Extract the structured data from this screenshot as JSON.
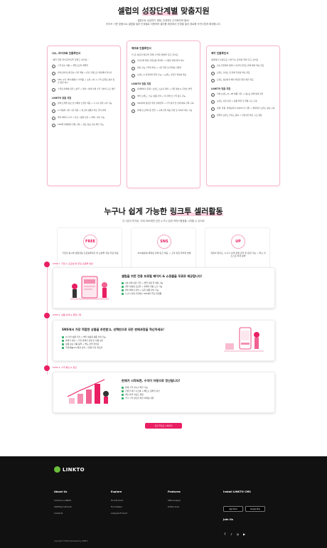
{
  "section1": {
    "title_plain": "셀럽의 ",
    "title_hl": "성장단계별",
    "title_rest": " 맞춤지원",
    "subtitle_l1": "셀럽으로 성공하기 위해, 단계적인 수익화전략 필요!",
    "subtitle_l2": "라이브 기준 맞춤으로 셀럽별 셀러 단계별로 지원하며 셀러를 확장에서 단계별 셀러 경로를 자연스럽게 확대합니다.",
    "cards": [
      {
        "head": "나노, 마이크로 인플루언서",
        "intro": "\"셀러 전환 파이프라인을 만들고 싶어요.\"",
        "items": [
          "수익 창출 처음 → 셀럽으로의 레벨업",
          "라이브커머스에 맞는 기본 역량 → 판단 전략으로 확장해야 합니다",
          "SNS 시작, 셀러(제품)수 어려움 → 소셜 시작 시 수익 모델로 효과 창출 방법 제시",
          "수익형 판매에 대한 노하우 → 제작 / 판매 실제 수익 기반의 구조 제안"
        ],
        "sec": "LINKTO 맞춤 지원",
        "sec_items": [
          "판매 트레벨 정보 및 판매율 소셜을 제공 → 누구나 쉽게 시작 가능",
          "AI 자동화 기반 시즌 대응 → 최고의 상품을 바로 골라 판매",
          "셀러 페이지 시작 → 판로 / 상품 선정 → 판매 / 관리 가능",
          "SNS별 판매채널 현황 구독 → 필요 정보 신속 확인 가능"
        ]
      },
      {
        "head": "매크로 인플루언서",
        "intro": "더 큰 성장과 매출을 위해 수익화 방법을 찾고 있어요",
        "items": [
          "자신만의 채널 콘텐츠를 최적화 → 다양한 판매 방식 제시",
          "제휴 가능 수익의 확장 → 시즌 협업 및 마케팅 다양화",
          "브랜드 & 협력사와 협업 가능 → 브랜드 사업가 확장성 확보"
        ],
        "sec": "LINKTO 맞춤 지원",
        "sec_items": [
          "상세페이지 운영 / 브랜드 스토리 제작 → 전문 영상 & 콘텐츠 발행",
          "셀러 브랜드 / 신규 상품 선택 → 각 판매 및 수익 창출 가능",
          "SNS판매 성장을 위한 판매전략 → 수익 분석 및 실제 예측 전략 구축",
          "판매/뉴스레터 등 협업 → 구매 전환 목표 달성 및 지속적 매출 가능"
        ]
      },
      {
        "head": "메가 인플루언서",
        "intro": "셀럽에서 브랜드로 나아가는 준비를 위해 갖고 싶어요",
        "items": [
          "단순 협찬에서 벗어나 나만의 콘텐츠 판매 채널 확보 필요",
          "브랜드 신뢰도 및 판매 안정성 확보 필요",
          "브랜드 성장성과 채널 확장을 위한 방안 필요"
        ],
        "sec": "LINKTO 맞춤 지원",
        "sec_items": [
          "자체 브랜드 PL, PB 제품 기획 → 대규모 판매 체계 실현",
          "브랜드 런칭 지원 → 상품 발굴 및 유통 구조 구축",
          "판매, 유통, 마케팅까지 LINKTO가 지원 → 체계적인 브랜드 성장 구축",
          "셀럽의 브랜드 인지도 증대 → 안정적인 매출 구조 형성"
        ]
      }
    ]
  },
  "section2": {
    "title_plain": "누구나 쉽게 가능한 ",
    "title_hl": "링크투 셀러활동",
    "subtitle": "단 2분의 투자로, 이제 SNS에만 있던 누구나 쉽게 커머스활동을 시작할 수 있어요",
    "benefits": [
      {
        "icon": "FREE",
        "text": "가입과 동시에 셀럽전용 프로필페이지 및 쇼핑몰 개설 무료 제공"
      },
      {
        "icon": "SNS",
        "text": "SNS활동에 특화된 판매 링크 제공 → 고객 유입 최적화 방법"
      },
      {
        "icon": "UP",
        "text": "직원이 없어도, 누구나 쉽게 판매 관리 및 운영 가능 → 최소 리소스로 최대 효율"
      }
    ],
    "steps": [
      {
        "label": "STEP 1. 가입 시 프로필 및 무료 쇼핑몰 생성",
        "title": "셀럽을 위한 전용 프로필 페이지 & 쇼핑몰을 무료로 제공합니다!",
        "lines": [
          "1분 만에 쉬운 가입 → 셀럽 전용 몰 생성 가능",
          "개인 맞춤형 프로필 → 판매자 맞춤 노출 가능",
          "셀러 페이지 관리 → 모든 상품 관리 가능",
          "누구나 쉽게 가입하는 SNS셀러 무료 플랫폼"
        ]
      },
      {
        "label": "STEP 2. 상품 선택 & 판매 시작",
        "title": "SNS에서 가장 적합한 상품을 추천받고, 선택만으로 모든 판매과정을 혁신하세요!",
        "lines": [
          "AI 기반 상품 추천 → 셀러 맞춤형 상품 선택 가능",
          "판매가 설정 → 추천 판매가 설정 및 자동 정산",
          "상품 정보 자동 등록 → 별도 작업 불필요",
          "주문/배송/CS 통합 관리 → 운영 부담 최소화"
        ]
      },
      {
        "label": "STEP 3. 수익 확인 & 정산",
        "title": "판매가 시작되면, 수익이 자동으로 정산됩니다!",
        "lines": [
          "판매 수익 실시간 확인 가능",
          "간편한 정산 시스템 → 빠르고 정확한 정산",
          "매출 분석 리포트 제공",
          "추가 수익 창출을 위한 마케팅 지원"
        ]
      }
    ],
    "cta": "지금 무료로 시작하기"
  },
  "footer": {
    "logo": "LINKTO",
    "columns": [
      {
        "head": "About Us",
        "links": [
          "Introduce LINKTO",
          "Staff Recruitment",
          "Contacts"
        ]
      },
      {
        "head": "Explore",
        "links": [
          "Find Product",
          "Find Sellers",
          "Analysis Product"
        ]
      },
      {
        "head": "Features",
        "links": [
          "SNS analysis",
          "Profile links"
        ]
      }
    ],
    "install_head": "Install LINKTO CMS",
    "app_store": "App Store",
    "google_play": "Google Play",
    "join_head": "Join Us",
    "copyright": "Copyright ©2025 Developed by LINKTO"
  }
}
